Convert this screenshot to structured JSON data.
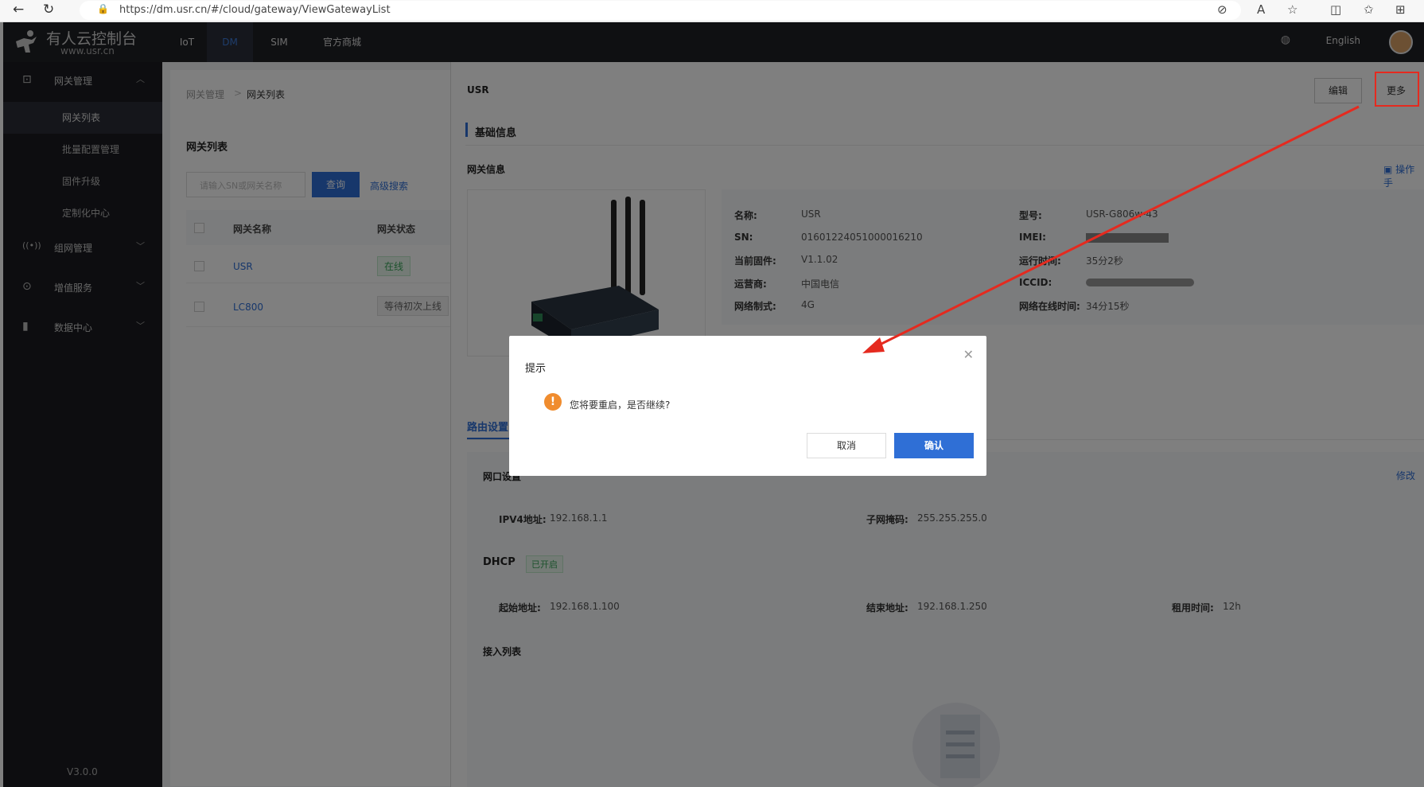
{
  "browser": {
    "url": "https://dm.usr.cn/#/cloud/gateway/ViewGatewayList"
  },
  "topnav": {
    "logo_title": "有人云控制台",
    "logo_sub": "www.usr.cn",
    "items": [
      "IoT",
      "DM",
      "SIM",
      "官方商城"
    ],
    "active": "DM",
    "language": "English"
  },
  "sidebar": {
    "groups": [
      {
        "label": "网关管理",
        "expanded": true,
        "sub": [
          "网关列表",
          "批量配置管理",
          "固件升级",
          "定制化中心"
        ],
        "active_sub": "网关列表"
      },
      {
        "label": "组网管理",
        "expanded": false
      },
      {
        "label": "增值服务",
        "expanded": false
      },
      {
        "label": "数据中心",
        "expanded": false
      }
    ],
    "version": "V3.0.0"
  },
  "list": {
    "breadcrumb": [
      "网关管理",
      "网关列表"
    ],
    "title": "网关列表",
    "search_placeholder": "请输入SN或网关名称",
    "query_label": "查询",
    "advanced_label": "高级搜索",
    "columns": [
      "网关名称",
      "网关状态"
    ],
    "rows": [
      {
        "name": "USR",
        "status": "在线"
      },
      {
        "name": "LC800",
        "status": "等待初次上线"
      }
    ]
  },
  "detail": {
    "name": "USR",
    "edit_label": "编辑",
    "more_label": "更多",
    "section_basic": "基础信息",
    "gateway_info_title": "网关信息",
    "manual_label": "操作手",
    "info_left": [
      {
        "label": "名称:",
        "value": "USR"
      },
      {
        "label": "SN:",
        "value": "01601224051000016210"
      },
      {
        "label": "当前固件:",
        "value": "V1.1.02"
      },
      {
        "label": "运营商:",
        "value": "中国电信"
      },
      {
        "label": "网络制式:",
        "value": "4G"
      }
    ],
    "info_right": [
      {
        "label": "型号:",
        "value": "USR-G806w-43"
      },
      {
        "label": "IMEI:",
        "value": ""
      },
      {
        "label": "运行时间:",
        "value": "35分2秒"
      },
      {
        "label": "ICCID:",
        "value": ""
      },
      {
        "label": "网络在线时间:",
        "value": "34分15秒"
      }
    ],
    "route_tab": "路由设置",
    "port_title": "网口设置",
    "modify_label": "修改",
    "ipv4_label": "IPV4地址:",
    "ipv4": "192.168.1.1",
    "mask_label": "子网掩码:",
    "mask": "255.255.255.0",
    "dhcp_title": "DHCP",
    "dhcp_status": "已开启",
    "start_label": "起始地址:",
    "start": "192.168.1.100",
    "end_label": "结束地址:",
    "end": "192.168.1.250",
    "lease_label": "租用时间:",
    "lease": "12h",
    "access_title": "接入列表"
  },
  "dialog": {
    "title": "提示",
    "message": "您将要重启，是否继续?",
    "cancel": "取消",
    "confirm": "确认"
  },
  "colors": {
    "primary": "#2f6fd6",
    "warning": "#f08c2e",
    "annotation": "#e52a1f",
    "sidebar_bg": "#1a1b20"
  }
}
